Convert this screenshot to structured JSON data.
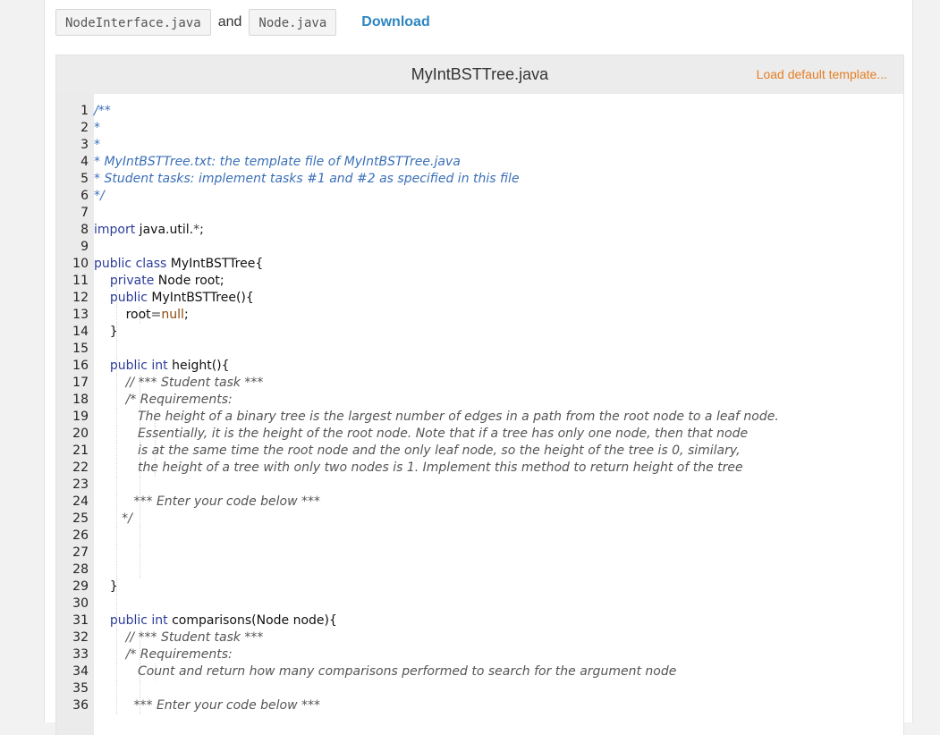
{
  "files": {
    "file1": "NodeInterface.java",
    "and_text": "and",
    "file2": "Node.java",
    "download_label": "Download"
  },
  "editor": {
    "title": "MyIntBSTTree.java",
    "load_template_label": "Load default template..."
  },
  "code_lines": [
    {
      "n": "1",
      "segs": [
        {
          "t": "/**",
          "c": "doc"
        }
      ],
      "guides": 0
    },
    {
      "n": "2",
      "segs": [
        {
          "t": "*",
          "c": "doc"
        }
      ],
      "guides": 0
    },
    {
      "n": "3",
      "segs": [
        {
          "t": "*",
          "c": "doc"
        }
      ],
      "guides": 0
    },
    {
      "n": "4",
      "segs": [
        {
          "t": "* MyIntBSTTree.txt: the template file of MyIntBSTTree.java",
          "c": "doc"
        }
      ],
      "guides": 0
    },
    {
      "n": "5",
      "segs": [
        {
          "t": "* Student tasks: implement tasks #1 and #2 as specified in this file",
          "c": "doc"
        }
      ],
      "guides": 0
    },
    {
      "n": "6",
      "segs": [
        {
          "t": "*/",
          "c": "doc"
        }
      ],
      "guides": 0
    },
    {
      "n": "7",
      "segs": [],
      "guides": 0
    },
    {
      "n": "8",
      "segs": [
        {
          "t": "import",
          "c": "kw"
        },
        {
          "t": " java.util.",
          "c": ""
        },
        {
          "t": "*",
          "c": "op"
        },
        {
          "t": ";",
          "c": ""
        }
      ],
      "guides": 0
    },
    {
      "n": "9",
      "segs": [],
      "guides": 0
    },
    {
      "n": "10",
      "segs": [
        {
          "t": "public class",
          "c": "kw"
        },
        {
          "t": " MyIntBSTTree{",
          "c": ""
        }
      ],
      "guides": 0
    },
    {
      "n": "11",
      "segs": [
        {
          "t": "    ",
          "c": ""
        },
        {
          "t": "private",
          "c": "kw"
        },
        {
          "t": " Node root;",
          "c": ""
        }
      ],
      "guides": 1
    },
    {
      "n": "12",
      "segs": [
        {
          "t": "    ",
          "c": ""
        },
        {
          "t": "public",
          "c": "kw"
        },
        {
          "t": " MyIntBSTTree(){",
          "c": ""
        }
      ],
      "guides": 1
    },
    {
      "n": "13",
      "segs": [
        {
          "t": "        root",
          "c": ""
        },
        {
          "t": "=",
          "c": "op"
        },
        {
          "t": "null",
          "c": "nul"
        },
        {
          "t": ";",
          "c": ""
        }
      ],
      "guides": 2
    },
    {
      "n": "14",
      "segs": [
        {
          "t": "    }",
          "c": ""
        }
      ],
      "guides": 1
    },
    {
      "n": "15",
      "segs": [],
      "guides": 1
    },
    {
      "n": "16",
      "segs": [
        {
          "t": "    ",
          "c": ""
        },
        {
          "t": "public int",
          "c": "kw"
        },
        {
          "t": " height(){",
          "c": ""
        }
      ],
      "guides": 1
    },
    {
      "n": "17",
      "segs": [
        {
          "t": "        ",
          "c": ""
        },
        {
          "t": "// *** Student task ***",
          "c": "cmt"
        }
      ],
      "guides": 2
    },
    {
      "n": "18",
      "segs": [
        {
          "t": "        ",
          "c": ""
        },
        {
          "t": "/* Requirements:",
          "c": "cmt"
        }
      ],
      "guides": 2
    },
    {
      "n": "19",
      "segs": [
        {
          "t": "           ",
          "c": ""
        },
        {
          "t": "The height of a binary tree is the largest number of edges in a path from the root node to a leaf node.",
          "c": "cmt"
        }
      ],
      "guides": 3
    },
    {
      "n": "20",
      "segs": [
        {
          "t": "           ",
          "c": ""
        },
        {
          "t": "Essentially, it is the height of the root node. Note that if a tree has only one node, then that node",
          "c": "cmt"
        }
      ],
      "guides": 3
    },
    {
      "n": "21",
      "segs": [
        {
          "t": "           ",
          "c": ""
        },
        {
          "t": "is at the same time the root node and the only leaf node, so the height of the tree is 0, similary,",
          "c": "cmt"
        }
      ],
      "guides": 3
    },
    {
      "n": "22",
      "segs": [
        {
          "t": "           ",
          "c": ""
        },
        {
          "t": "the height of a tree with only two nodes is 1. Implement this method to return height of the tree",
          "c": "cmt"
        }
      ],
      "guides": 3
    },
    {
      "n": "23",
      "segs": [],
      "guides": 2
    },
    {
      "n": "24",
      "segs": [
        {
          "t": "          ",
          "c": ""
        },
        {
          "t": "*** Enter your code below ***",
          "c": "cmt"
        }
      ],
      "guides": 2
    },
    {
      "n": "25",
      "segs": [
        {
          "t": "       ",
          "c": ""
        },
        {
          "t": "*/",
          "c": "cmt"
        }
      ],
      "guides": 2
    },
    {
      "n": "26",
      "segs": [],
      "guides": 2
    },
    {
      "n": "27",
      "segs": [],
      "guides": 2
    },
    {
      "n": "28",
      "segs": [],
      "guides": 2
    },
    {
      "n": "29",
      "segs": [
        {
          "t": "    }",
          "c": ""
        }
      ],
      "guides": 1
    },
    {
      "n": "30",
      "segs": [],
      "guides": 1
    },
    {
      "n": "31",
      "segs": [
        {
          "t": "    ",
          "c": ""
        },
        {
          "t": "public int",
          "c": "kw"
        },
        {
          "t": " comparisons(Node node){",
          "c": ""
        }
      ],
      "guides": 1
    },
    {
      "n": "32",
      "segs": [
        {
          "t": "        ",
          "c": ""
        },
        {
          "t": "// *** Student task ***",
          "c": "cmt"
        }
      ],
      "guides": 2
    },
    {
      "n": "33",
      "segs": [
        {
          "t": "        ",
          "c": ""
        },
        {
          "t": "/* Requirements:",
          "c": "cmt"
        }
      ],
      "guides": 2
    },
    {
      "n": "34",
      "segs": [
        {
          "t": "           ",
          "c": ""
        },
        {
          "t": "Count and return how many comparisons performed to search for the argument node",
          "c": "cmt"
        }
      ],
      "guides": 3
    },
    {
      "n": "35",
      "segs": [],
      "guides": 2
    },
    {
      "n": "36",
      "segs": [
        {
          "t": "          ",
          "c": ""
        },
        {
          "t": "*** Enter your code below ***",
          "c": "cmt"
        }
      ],
      "guides": 2
    }
  ]
}
